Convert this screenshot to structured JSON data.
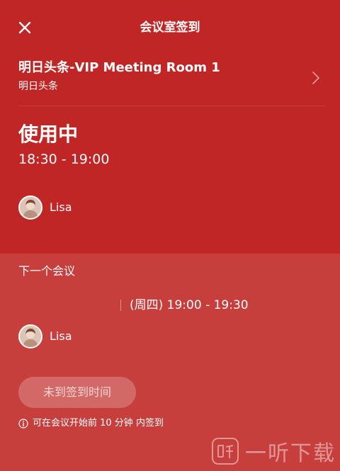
{
  "header": {
    "title": "会议室签到",
    "close_icon": "close-icon"
  },
  "room": {
    "name": "明日头条-VIP Meeting Room 1",
    "subtitle": "明日头条",
    "chevron_icon": "chevron-right-icon"
  },
  "current": {
    "status": "使用中",
    "time": "18:30 - 19:00",
    "organizer": "Lisa"
  },
  "next": {
    "title": "下一个会议",
    "time": "(周四) 19:00 - 19:30",
    "organizer": "Lisa"
  },
  "checkin": {
    "button_label": "未到签到时间",
    "hint": "可在会议开始前 10 分钟 内签到",
    "hint_icon": "info-icon"
  },
  "watermark": {
    "text": "一听下载"
  },
  "colors": {
    "header_bg": "#c02626",
    "body_bg": "#c63f3d",
    "text": "#ffffff"
  }
}
